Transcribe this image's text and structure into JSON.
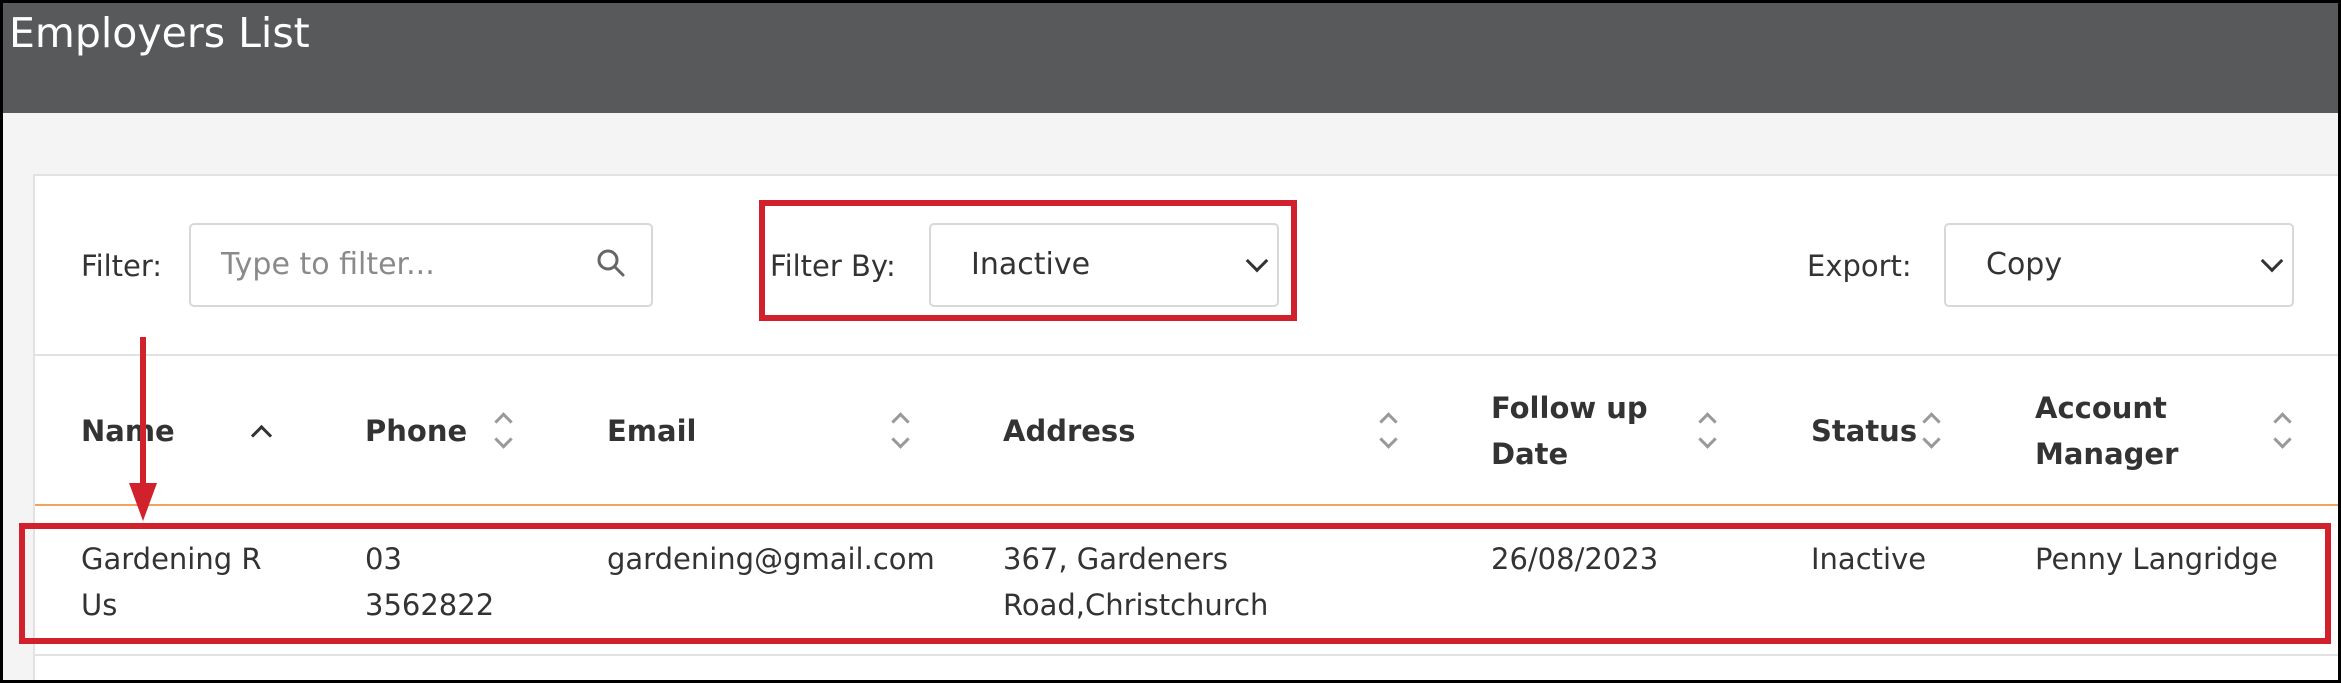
{
  "header": {
    "title": "Employers List"
  },
  "toolbar": {
    "filter_label": "Filter:",
    "filter_placeholder": "Type to filter...",
    "filter_by_label": "Filter By:",
    "filter_by_value": "Inactive",
    "export_label": "Export:",
    "export_value": "Copy"
  },
  "table": {
    "columns": [
      {
        "lines": [
          "Name"
        ]
      },
      {
        "lines": [
          "Phone"
        ]
      },
      {
        "lines": [
          "Email"
        ]
      },
      {
        "lines": [
          "Address"
        ]
      },
      {
        "lines": [
          "Follow up",
          "Date"
        ]
      },
      {
        "lines": [
          "Status"
        ]
      },
      {
        "lines": [
          "Account",
          "Manager"
        ]
      }
    ],
    "rows": [
      {
        "name": [
          "Gardening R",
          "Us"
        ],
        "phone": [
          "03",
          "3562822"
        ],
        "email": "gardening@gmail.com",
        "address": [
          "367, Gardeners",
          "Road,Christchurch"
        ],
        "follow_up": "26/08/2023",
        "status": "Inactive",
        "account_manager": "Penny Langridge"
      }
    ]
  },
  "colors": {
    "header_bg": "#58595b",
    "highlight": "#d1212d",
    "header_divider": "#f0a35e"
  }
}
